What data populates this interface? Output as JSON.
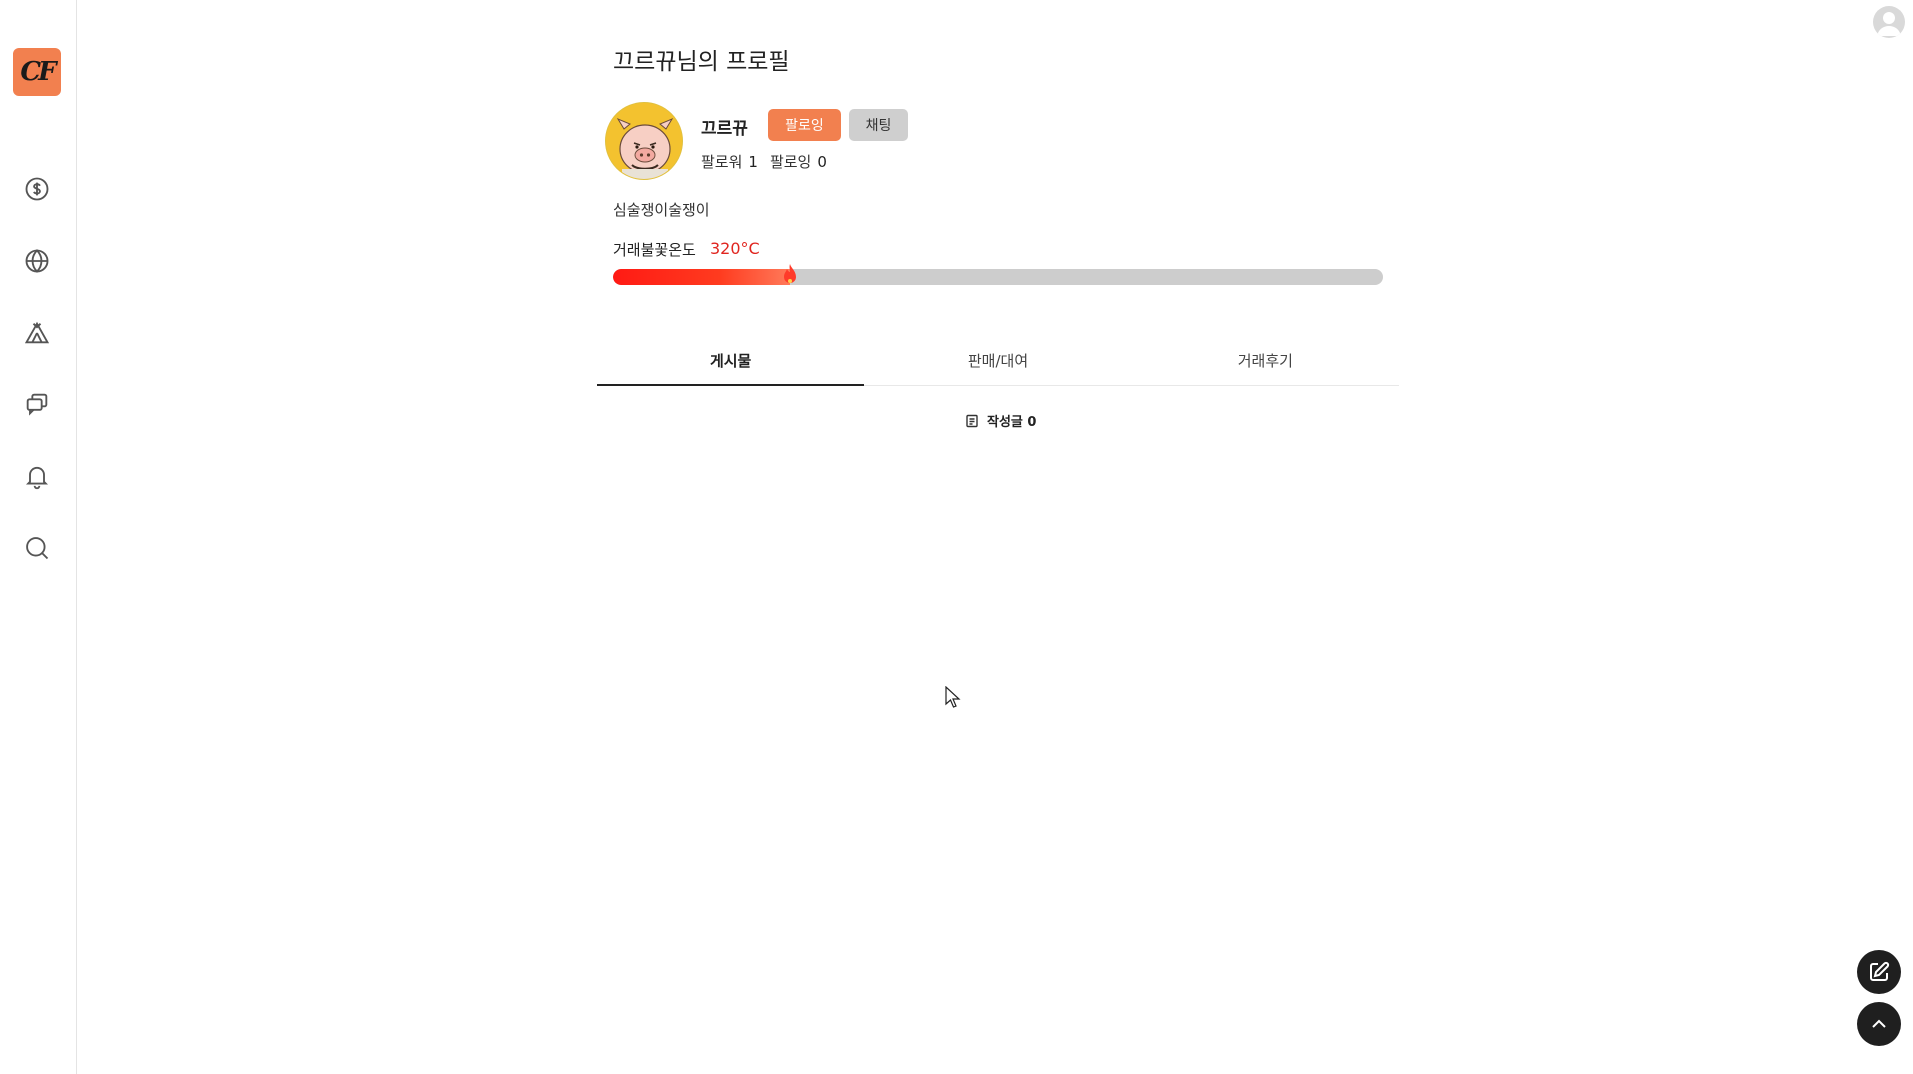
{
  "app": {
    "logo_text": "CF"
  },
  "sidebar": {
    "items": [
      {
        "name": "dollar-icon"
      },
      {
        "name": "globe-icon"
      },
      {
        "name": "tent-icon"
      },
      {
        "name": "chat-icon"
      },
      {
        "name": "bell-icon"
      },
      {
        "name": "search-icon"
      }
    ]
  },
  "profile": {
    "page_title": "끄르뀨님의 프로필",
    "nickname": "끄르뀨",
    "follow_label": "팔로잉",
    "chat_label": "채팅",
    "followers_label": "팔로워",
    "followers_count": "1",
    "following_label": "팔로잉",
    "following_count": "0",
    "bio": "심술쟁이술쟁이",
    "temperature_label": "거래불꽃온도",
    "temperature_value": "320°C",
    "temperature_fraction": 0.23
  },
  "tabs": [
    {
      "label": "게시물",
      "active": true
    },
    {
      "label": "판매/대여",
      "active": false
    },
    {
      "label": "거래후기",
      "active": false
    }
  ],
  "posts": {
    "count_label": "작성글 0"
  },
  "colors": {
    "accent": "#f2804f",
    "temperature": "#e0251f",
    "chat_button": "#cfcfcf"
  }
}
